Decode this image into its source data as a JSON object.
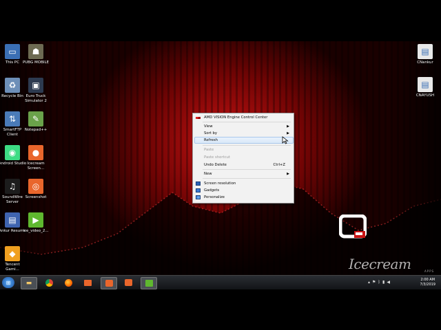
{
  "desktop_icons_left": [
    {
      "label": "This PC",
      "icon": "computer-icon",
      "color": "#3b6fb5"
    },
    {
      "label": "PUBG MOBILE",
      "icon": "pubg-icon",
      "color": "#6d6a52"
    },
    {
      "label": "Recycle Bin",
      "icon": "recycle-bin-icon",
      "color": "#6d8fb8"
    },
    {
      "label": "Euro Truck Simulator 2",
      "icon": "truck-icon",
      "color": "#2d3a50"
    },
    {
      "label": "SmartFTP Client",
      "icon": "ftp-icon",
      "color": "#4a7bb8"
    },
    {
      "label": "Notepad++",
      "icon": "notepad-icon",
      "color": "#6aa24a"
    },
    {
      "label": "Android Studio",
      "icon": "android-icon",
      "color": "#3ddc84"
    },
    {
      "label": "Icecream Screen...",
      "icon": "icecream-icon",
      "color": "#e9662c"
    },
    {
      "label": "SoundWire Server",
      "icon": "soundwire-icon",
      "color": "#1c1c1c"
    },
    {
      "label": "Screenshot",
      "icon": "screenshot-icon",
      "color": "#e9662c"
    },
    {
      "label": "Ankur Resume",
      "icon": "document-icon",
      "color": "#3f64b0"
    },
    {
      "label": "ice_video_2...",
      "icon": "video-play-icon",
      "color": "#5fb82f"
    },
    {
      "label": "Tencent Gami...",
      "icon": "tencent-icon",
      "color": "#f0a020"
    }
  ],
  "desktop_icons_right": [
    {
      "label": "CNankur",
      "icon": "file-icon"
    },
    {
      "label": "CNAYUSH",
      "icon": "file-icon"
    }
  ],
  "context_menu": {
    "header": "AMD VISION Engine Control Center",
    "view": "View",
    "sort_by": "Sort by",
    "refresh": "Refresh",
    "paste": "Paste",
    "paste_shortcut": "Paste shortcut",
    "undo_delete": "Undo Delete",
    "undo_shortcut": "Ctrl+Z",
    "new": "New",
    "screen_resolution": "Screen resolution",
    "gadgets": "Gadgets",
    "personalize": "Personalize"
  },
  "taskbar": {
    "clock_time": "2:00 AM",
    "clock_date": "7/3/2019"
  },
  "watermark": {
    "brand": "Icecream",
    "sub": "APPS"
  },
  "colors": {
    "wallpaper_red": "#c81414",
    "menu_bg": "#f2f2f2",
    "highlight": "#d9e8f8"
  }
}
